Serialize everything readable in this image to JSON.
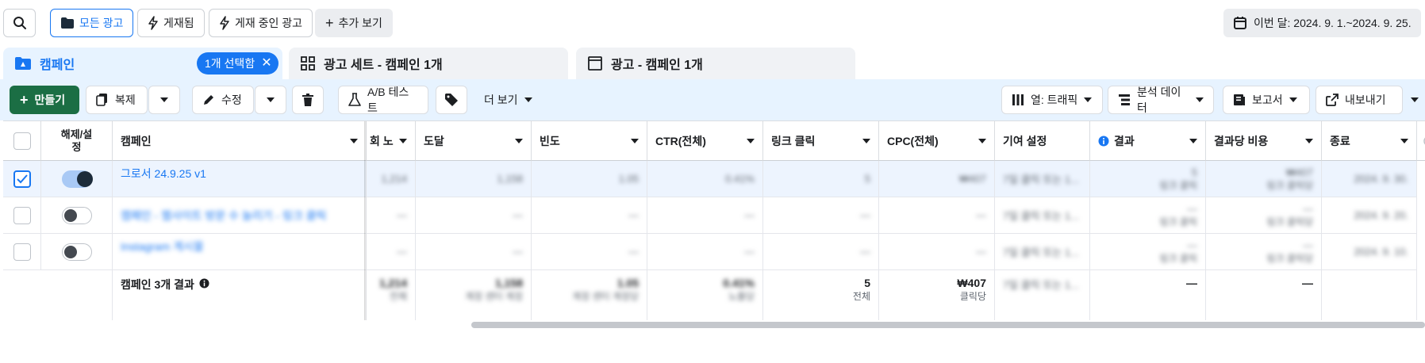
{
  "filters": {
    "all_ads": "모든 광고",
    "published": "게재됨",
    "active_ads": "게재 중인 광고",
    "more": "추가 보기",
    "date_range": "이번 달: 2024. 9. 1.~2024. 9. 25."
  },
  "tabs": {
    "campaign": "캠페인",
    "selected_pill": "1개 선택함",
    "adset": "광고 세트 - 캠페인 1개",
    "ad": "광고 - 캠페인 1개"
  },
  "toolbar": {
    "create": "만들기",
    "duplicate": "복제",
    "edit": "수정",
    "ab_test": "A/B 테스트",
    "more": "더 보기",
    "columns": "열: 트래픽",
    "breakdown": "분석 데이터",
    "reports": "보고서",
    "export": "내보내기"
  },
  "table": {
    "headers": {
      "toggle": "해제/설정",
      "campaign": "캠페인",
      "impressions_partial": "회 노",
      "reach": "도달",
      "frequency": "빈도",
      "ctr": "CTR(전체)",
      "link_clicks": "링크 클릭",
      "cpc": "CPC(전체)",
      "attribution": "기여 설정",
      "results": "결과",
      "cost_per_result": "결과당 비용",
      "ends": "종료"
    },
    "rows": [
      {
        "name": "그로서 24.9.25 v1",
        "impressions": "1,214",
        "reach": "1,158",
        "frequency": "1.05",
        "ctr": "0.41%",
        "link_clicks": "5",
        "cpc": "₩407",
        "attribution": "7일 클릭 또는 1...",
        "results": "5",
        "results_sub": "링크 클릭",
        "cost": "₩407",
        "cost_sub": "링크 클릭당",
        "ends": "2024. 9. 30."
      },
      {
        "name": "캠페인 - 웹사이트 방문 수 늘리기 - 링크 클릭",
        "impressions": "—",
        "reach": "—",
        "frequency": "—",
        "ctr": "—",
        "link_clicks": "—",
        "cpc": "—",
        "attribution": "7일 클릭 또는 1...",
        "results": "—",
        "results_sub": "링크 클릭",
        "cost": "—",
        "cost_sub": "링크 클릭당",
        "ends": "2024. 9. 20."
      },
      {
        "name": "Instagram 게시물",
        "impressions": "—",
        "reach": "—",
        "frequency": "—",
        "ctr": "—",
        "link_clicks": "—",
        "cpc": "—",
        "attribution": "7일 클릭 또는 1...",
        "results": "—",
        "results_sub": "링크 클릭",
        "cost": "—",
        "cost_sub": "링크 클릭당",
        "ends": "2024. 9. 10."
      }
    ],
    "summary": {
      "label": "캠페인 3개 결과",
      "impressions": "1,214",
      "impressions_sub": "전체",
      "reach": "1,158",
      "reach_sub": "계정 센터 계정",
      "frequency": "1.05",
      "frequency_sub": "계정 센터 계정당",
      "ctr": "0.41%",
      "ctr_sub": "노출당",
      "link_clicks": "5",
      "link_clicks_sub": "전체",
      "cpc": "₩407",
      "cpc_sub": "클릭당",
      "attribution": "7일 클릭 또는 1...",
      "results": "—",
      "cost": "—"
    }
  },
  "colors": {
    "accent": "#1877f2",
    "create_button": "#1b6e44",
    "selected_row": "#edf4fe",
    "toolbar_bg": "#e7f3ff"
  }
}
